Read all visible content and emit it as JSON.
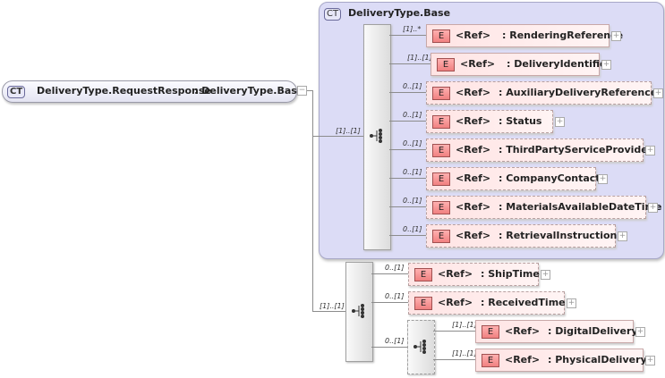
{
  "root": {
    "badge": "CT",
    "name": "DeliveryType.RequestResponse",
    "base": ": DeliveryType.Base"
  },
  "container": {
    "badge": "CT",
    "title": "DeliveryType.Base"
  },
  "seq1_card": "[1]..[1]",
  "seq2_card": "[1]..[1]",
  "choice_card": "0..[1]",
  "elements": [
    {
      "card": "[1]..*",
      "badge": "E",
      "ref": "<Ref>",
      "name": ": RenderingReference"
    },
    {
      "card": "[1]..[1]",
      "badge": "E",
      "ref": "<Ref>",
      "name": ": DeliveryIdentifier"
    },
    {
      "card": "0..[1]",
      "badge": "E",
      "ref": "<Ref>",
      "name": ": AuxiliaryDeliveryReferences"
    },
    {
      "card": "0..[1]",
      "badge": "E",
      "ref": "<Ref>",
      "name": ": Status"
    },
    {
      "card": "0..[1]",
      "badge": "E",
      "ref": "<Ref>",
      "name": ": ThirdPartyServiceProvider"
    },
    {
      "card": "0..[1]",
      "badge": "E",
      "ref": "<Ref>",
      "name": ": CompanyContact"
    },
    {
      "card": "0..[1]",
      "badge": "E",
      "ref": "<Ref>",
      "name": ": MaterialsAvailableDateTime"
    },
    {
      "card": "0..[1]",
      "badge": "E",
      "ref": "<Ref>",
      "name": ": RetrievalInstructions"
    },
    {
      "card": "0..[1]",
      "badge": "E",
      "ref": "<Ref>",
      "name": ": ShipTime"
    },
    {
      "card": "0..[1]",
      "badge": "E",
      "ref": "<Ref>",
      "name": ": ReceivedTime"
    },
    {
      "card": "[1]..[1]",
      "badge": "E",
      "ref": "<Ref>",
      "name": ": DigitalDelivery"
    },
    {
      "card": "[1]..[1]",
      "badge": "E",
      "ref": "<Ref>",
      "name": ": PhysicalDelivery"
    }
  ]
}
